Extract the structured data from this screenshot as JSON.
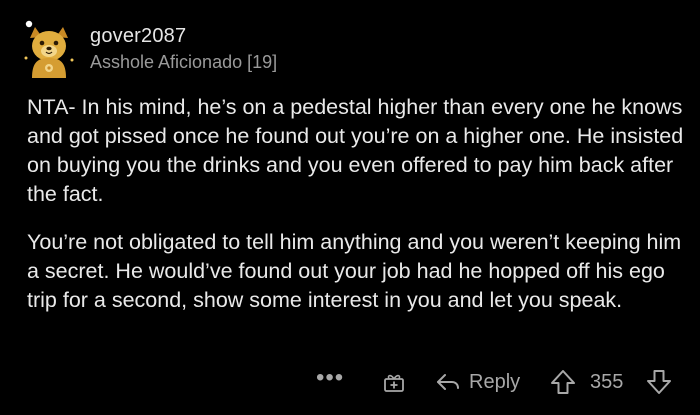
{
  "comment": {
    "author": {
      "username": "gover2087",
      "flair": "Asshole Aficionado [19]",
      "avatar_icon": "golden-dog-avatar-icon"
    },
    "paragraphs": [
      "NTA- In his mind, he’s on a pedestal higher than every one he knows and got pissed once he found out you’re on a higher one. He insisted on buying you the drinks and you even offered to pay him back after the fact.",
      "You’re not obligated to tell him anything and you weren’t keeping him a secret. He would’ve found out your job had he hopped off his ego trip for a second, show some interest in you and let you speak."
    ],
    "actions": {
      "more_label": "•••",
      "reply_label": "Reply",
      "score": "355",
      "icons": {
        "more": "more-icon",
        "award": "award-icon",
        "reply": "reply-arrow-icon",
        "upvote": "upvote-arrow-icon",
        "downvote": "downvote-arrow-icon"
      }
    }
  },
  "colors": {
    "background": "#000000",
    "text": "#e9e9e9",
    "muted": "#9a9a9a",
    "icon": "#a8a8a8",
    "avatar_gold": "#d9a53a"
  }
}
